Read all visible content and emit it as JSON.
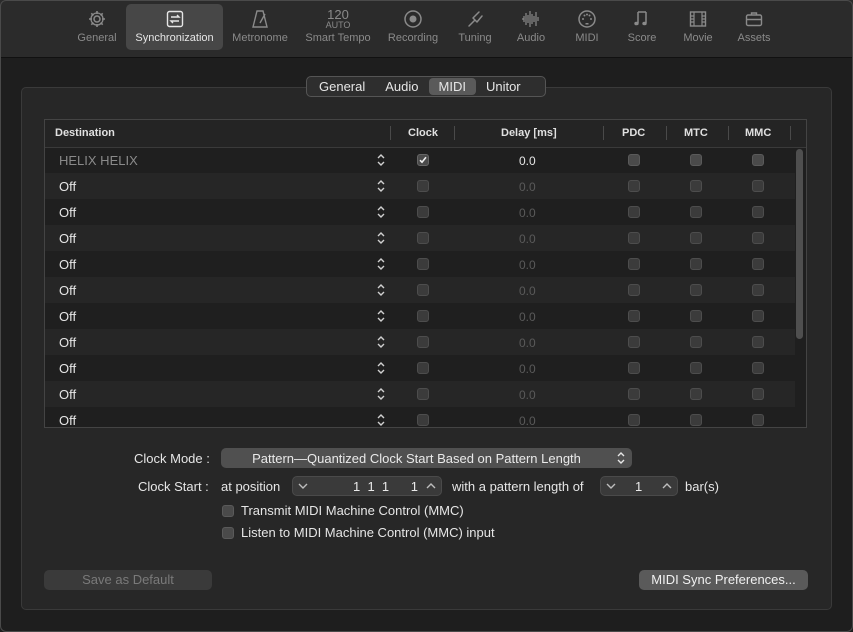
{
  "toolbar": {
    "items": [
      {
        "label": "General",
        "icon": "gear-icon"
      },
      {
        "label": "Synchronization",
        "icon": "sync-icon",
        "active": true
      },
      {
        "label": "Metronome",
        "icon": "metronome-icon"
      },
      {
        "label": "Smart Tempo",
        "icon": "tempo-icon",
        "tempo_value": "120",
        "tempo_mode": "AUTO"
      },
      {
        "label": "Recording",
        "icon": "record-icon"
      },
      {
        "label": "Tuning",
        "icon": "tuning-fork-icon"
      },
      {
        "label": "Audio",
        "icon": "waveform-icon"
      },
      {
        "label": "MIDI",
        "icon": "midi-icon"
      },
      {
        "label": "Score",
        "icon": "notes-icon"
      },
      {
        "label": "Movie",
        "icon": "film-icon"
      },
      {
        "label": "Assets",
        "icon": "briefcase-icon"
      }
    ]
  },
  "tabs": {
    "items": [
      {
        "label": "General"
      },
      {
        "label": "Audio"
      },
      {
        "label": "MIDI",
        "active": true
      },
      {
        "label": "Unitor"
      }
    ]
  },
  "table": {
    "columns": {
      "destination": "Destination",
      "clock": "Clock",
      "delay": "Delay [ms]",
      "pdc": "PDC",
      "mtc": "MTC",
      "mmc": "MMC"
    },
    "rows": [
      {
        "destination": "HELIX HELIX",
        "clock": true,
        "delay": "0.0",
        "active": true
      },
      {
        "destination": "Off",
        "clock": false,
        "delay": "0.0"
      },
      {
        "destination": "Off",
        "clock": false,
        "delay": "0.0"
      },
      {
        "destination": "Off",
        "clock": false,
        "delay": "0.0"
      },
      {
        "destination": "Off",
        "clock": false,
        "delay": "0.0"
      },
      {
        "destination": "Off",
        "clock": false,
        "delay": "0.0"
      },
      {
        "destination": "Off",
        "clock": false,
        "delay": "0.0"
      },
      {
        "destination": "Off",
        "clock": false,
        "delay": "0.0"
      },
      {
        "destination": "Off",
        "clock": false,
        "delay": "0.0"
      },
      {
        "destination": "Off",
        "clock": false,
        "delay": "0.0"
      },
      {
        "destination": "Off",
        "clock": false,
        "delay": "0.0"
      }
    ]
  },
  "clock_mode": {
    "label": "Clock Mode :",
    "value": "Pattern—Quantized Clock Start Based on Pattern Length"
  },
  "clock_start": {
    "label": "Clock Start :",
    "at_position": "at position",
    "position_value": "1  1  1      1",
    "pattern_length_label": "with a pattern length of",
    "pattern_length_value": "1",
    "unit": "bar(s)"
  },
  "options": {
    "transmit_mmc": "Transmit MIDI Machine Control (MMC)",
    "listen_mmc": "Listen to MIDI Machine Control (MMC) input"
  },
  "buttons": {
    "save_default": "Save as Default",
    "sync_prefs": "MIDI Sync Preferences..."
  },
  "colors": {
    "accent_active": "#474747",
    "background": "#1e1e1e",
    "panel": "#272727"
  }
}
